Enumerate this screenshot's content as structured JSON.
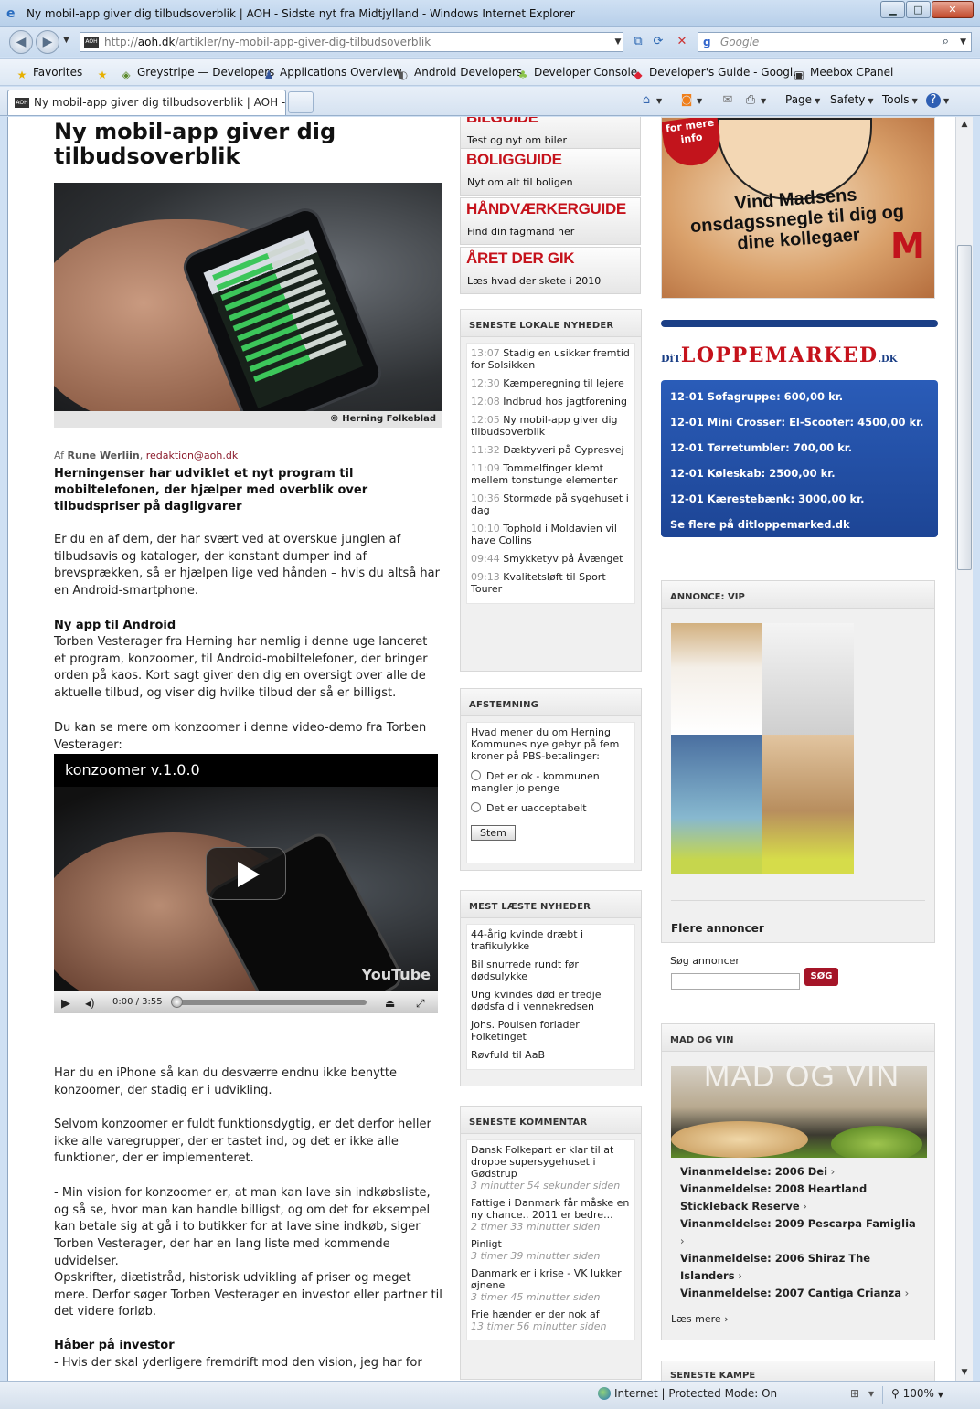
{
  "window": {
    "title": "Ny mobil-app giver dig tilbudsoverblik | AOH - Sidste nyt fra Midtjylland - Windows Internet Explorer",
    "minimize": "▁",
    "maximize": "□",
    "close": "✕"
  },
  "address": {
    "fav_label": "AOH",
    "url_prefix": "http://",
    "url_host": "aoh.dk",
    "url_path": "/artikler/ny-mobil-app-giver-dig-tilbudsoverblik",
    "search_placeholder": "Google"
  },
  "favorites_bar": {
    "favorites_label": "Favorites",
    "items": [
      {
        "label": "Greystripe — Developers",
        "icon": "greystripe-icon"
      },
      {
        "label": "Applications Overview",
        "icon": "people-icon"
      },
      {
        "label": "Android Developers",
        "icon": "android-icon"
      },
      {
        "label": "Developer Console",
        "icon": "android-icon"
      },
      {
        "label": "Developer's Guide - Googl...",
        "icon": "google-icon"
      },
      {
        "label": "Meebox CPanel",
        "icon": "meebox-icon"
      }
    ]
  },
  "tabs": [
    {
      "label": "Ny mobil-app giver dig tilbudsoverblik | AOH - Si..."
    }
  ],
  "command_bar": {
    "page": "Page",
    "safety": "Safety",
    "tools": "Tools"
  },
  "article": {
    "title": "Ny mobil-app giver dig tilbudsoverblik",
    "photo_caption": "© Herning Folkeblad",
    "byline_prefix": "Af",
    "author": "Rune Werliin",
    "email": "redaktion@aoh.dk",
    "lead": "Herningenser har udviklet et nyt program til mobiltelefonen, der hjælper med overblik over tilbudspriser på dagligvarer",
    "p1": "Er du en af dem, der har svært ved at overskue junglen af tilbudsavis og kataloger, der konstant dumper ind af brevsprækken, så er hjælpen lige ved hånden – hvis du altså har en Android-smartphone.",
    "h1": "Ny app til Android",
    "p2": "Torben Vesterager fra Herning har nemlig i denne uge lanceret et program, konzoomer, til Android-mobiltelefoner, der bringer orden på kaos. Kort sagt giver den dig en oversigt over alle de aktuelle tilbud, og viser dig hvilke tilbud der så er billigst.",
    "p3": "Du kan se mere om konzoomer i denne video-demo fra Torben Vesterager:",
    "video_title": "konzoomer v.1.0.0",
    "video_time": "0:00 / 3:55",
    "video_logo": "YouTube",
    "p4": "Har du en iPhone så kan du desværre endnu ikke benytte konzoomer, der stadig er i udvikling.",
    "p5": "Selvom konzoomer er fuldt funktionsdygtig, er det derfor heller ikke alle varegrupper, der er tastet ind, og det er ikke alle funktioner, der er implementeret.",
    "p6": "- Min vision for konzoomer er, at man kan lave sin indkøbsliste, og så se, hvor man kan handle billigst, og om det for eksempel kan betale sig at gå i to butikker for at lave sine indkøb, siger Torben Vesterager, der har en lang liste med kommende udvidelser.",
    "p7": "Opskrifter, diætistråd, historisk udvikling af priser og meget mere. Derfor søger Torben Vesterager en investor eller partner til det videre forløb.",
    "h2": "Håber på investor",
    "p8": "- Hvis der skal yderligere fremdrift mod den vision, jeg har for"
  },
  "banners": [
    {
      "title": "BILGUIDE",
      "sub": "Test og nyt om biler"
    },
    {
      "title": "BOLIGGUIDE",
      "sub": "Nyt om alt til boligen"
    },
    {
      "title": "HÅNDVÆRKERGUIDE",
      "sub": "Find din fagmand her"
    },
    {
      "title": "ÅRET DER GIK",
      "sub": "Læs hvad der skete i 2010"
    }
  ],
  "lokale": {
    "header": "SENESTE LOKALE NYHEDER",
    "items": [
      {
        "time": "13:07",
        "text": "Stadig en usikker fremtid for Solsikken"
      },
      {
        "time": "12:30",
        "text": "Kæmperegning til lejere"
      },
      {
        "time": "12:08",
        "text": "Indbrud hos jagtforening"
      },
      {
        "time": "12:05",
        "text": "Ny mobil-app giver dig tilbudsoverblik"
      },
      {
        "time": "11:32",
        "text": "Dæktyveri på Cypresvej"
      },
      {
        "time": "11:09",
        "text": "Tommelfinger klemt mellem tonstunge elementer"
      },
      {
        "time": "10:36",
        "text": "Stormøde på sygehuset i dag"
      },
      {
        "time": "10:10",
        "text": "Tophold i Moldavien vil have Collins"
      },
      {
        "time": "09:44",
        "text": "Smykketyv på Åvænget"
      },
      {
        "time": "09:13",
        "text": "Kvalitetsløft til Sport Tourer"
      }
    ]
  },
  "poll": {
    "header": "AFSTEMNING",
    "question": "Hvad mener du om Herning Kommunes nye gebyr på fem kroner på PBS-betalinger:",
    "option1": "Det er ok - kommunen mangler jo penge",
    "option2": "Det er uacceptabelt",
    "button": "Stem"
  },
  "mest": {
    "header": "MEST LÆSTE NYHEDER",
    "items": [
      "44-årig kvinde dræbt i trafikulykke",
      "Bil snurrede rundt før dødsulykke",
      "Ung kvindes død er tredje dødsfald i vennekredsen",
      "Johs. Poulsen forlader Folketinget",
      "Røvfuld til AaB"
    ]
  },
  "kommentar": {
    "header": "SENESTE KOMMENTAR",
    "items": [
      {
        "text": "Dansk Folkepart er klar til at droppe supersygehuset i Gødstrup",
        "ago": "3 minutter 54 sekunder siden"
      },
      {
        "text": "Fattige i Danmark får måske en ny chance.. 2011 er bedre...",
        "ago": "2 timer 33 minutter siden"
      },
      {
        "text": "Pinligt",
        "ago": "3 timer 39 minutter siden"
      },
      {
        "text": "Danmark er i krise - VK lukker øjnene",
        "ago": "3 timer 45 minutter siden"
      },
      {
        "text": "Frie hænder er der nok af",
        "ago": "13 timer 56 minutter siden"
      }
    ]
  },
  "ad_radio": {
    "info": "for mere info",
    "slogan": "Vind Madsens onsdagssnegle til dig og dine kollegaer",
    "brand": "M"
  },
  "loppemarked": {
    "logo_prefix": "DiT",
    "logo_main": "LOPPEMARKED",
    "logo_suffix": ".DK",
    "items": [
      "12-01 Sofagruppe: 600,00 kr.",
      "12-01 Mini Crosser: El-Scooter: 4500,00 kr.",
      "12-01 Tørretumbler: 700,00 kr.",
      "12-01 Køleskab: 2500,00 kr.",
      "12-01 Kærestebænk: 3000,00 kr.",
      "Se flere på ditloppemarked.dk"
    ]
  },
  "vip": {
    "header": "ANNONCE: VIP",
    "flere": "Flere annoncer",
    "sog_label": "Søg annoncer",
    "sog_button": "SØG"
  },
  "madvin": {
    "header": "MAD OG VIN",
    "image_text": "MAD OG VIN",
    "items": [
      "Vinanmeldelse: 2006 Dei",
      "Vinanmeldelse: 2008 Heartland Stickleback Reserve",
      "Vinanmeldelse: 2009 Pescarpa Famiglia",
      "Vinanmeldelse: 2006 Shiraz The Islanders",
      "Vinanmeldelse: 2007 Cantiga Crianza"
    ],
    "more": "Læs mere"
  },
  "seneste_kampe": "SENESTE KAMPE",
  "status": {
    "zone": "Internet | Protected Mode: On",
    "zoom": "100%"
  }
}
